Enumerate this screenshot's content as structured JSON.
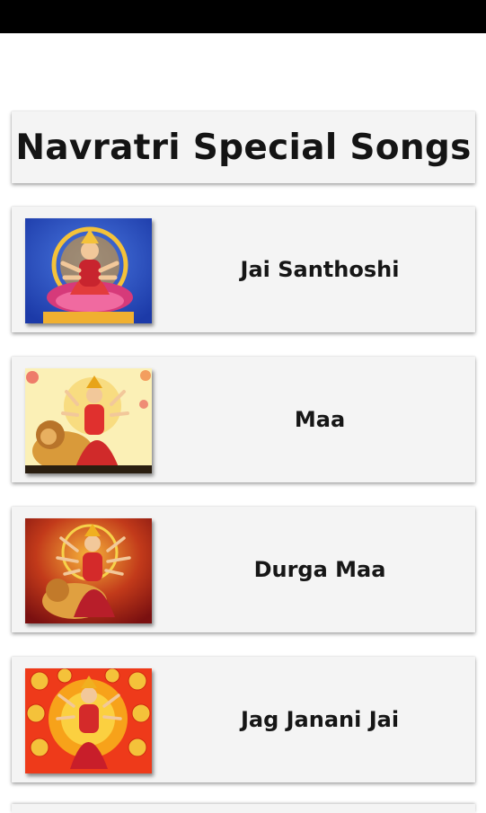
{
  "header": {
    "title": "Navratri Special Songs"
  },
  "songs": [
    {
      "label": "Jai Santhoshi",
      "image": "goddess-santoshi-image"
    },
    {
      "label": "Maa",
      "image": "goddess-durga-lion-image"
    },
    {
      "label": "Durga Maa",
      "image": "goddess-durga-red-image"
    },
    {
      "label": "Jag Janani Jai",
      "image": "goddess-navdurga-image"
    }
  ],
  "colors": {
    "status_bar": "#000000",
    "card_background": "#f4f4f4",
    "text": "#161616"
  }
}
